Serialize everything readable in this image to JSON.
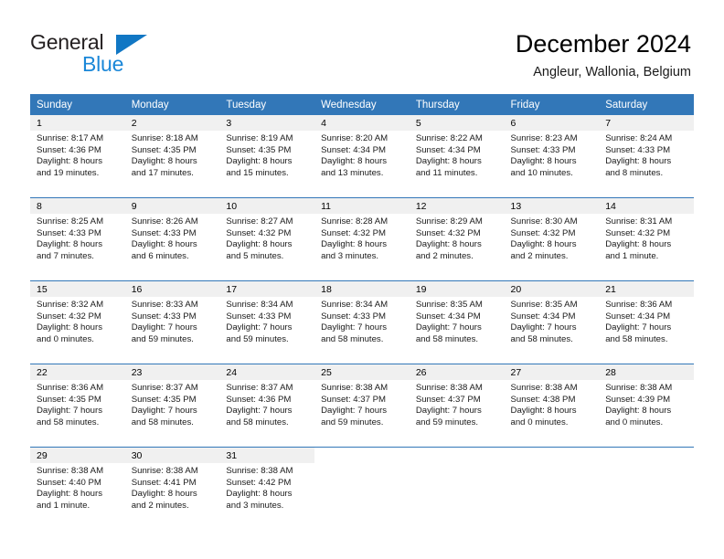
{
  "brand": {
    "name_part1": "General",
    "name_part2": "Blue",
    "logo_icon": "blue-triangle-icon",
    "colors": {
      "dark": "#231f20",
      "blue": "#1a87d8",
      "triangle": "#1177c4"
    }
  },
  "header": {
    "title": "December 2024",
    "subtitle": "Angleur, Wallonia, Belgium"
  },
  "theme": {
    "header_blue": "#3277b8",
    "daynum_band": "#f0f0f0",
    "text": "#1a1a1a"
  },
  "calendar": {
    "weekday_headers": [
      "Sunday",
      "Monday",
      "Tuesday",
      "Wednesday",
      "Thursday",
      "Friday",
      "Saturday"
    ],
    "weeks": [
      [
        {
          "day": "1",
          "sunrise": "Sunrise: 8:17 AM",
          "sunset": "Sunset: 4:36 PM",
          "daylight_line1": "Daylight: 8 hours",
          "daylight_line2": "and 19 minutes."
        },
        {
          "day": "2",
          "sunrise": "Sunrise: 8:18 AM",
          "sunset": "Sunset: 4:35 PM",
          "daylight_line1": "Daylight: 8 hours",
          "daylight_line2": "and 17 minutes."
        },
        {
          "day": "3",
          "sunrise": "Sunrise: 8:19 AM",
          "sunset": "Sunset: 4:35 PM",
          "daylight_line1": "Daylight: 8 hours",
          "daylight_line2": "and 15 minutes."
        },
        {
          "day": "4",
          "sunrise": "Sunrise: 8:20 AM",
          "sunset": "Sunset: 4:34 PM",
          "daylight_line1": "Daylight: 8 hours",
          "daylight_line2": "and 13 minutes."
        },
        {
          "day": "5",
          "sunrise": "Sunrise: 8:22 AM",
          "sunset": "Sunset: 4:34 PM",
          "daylight_line1": "Daylight: 8 hours",
          "daylight_line2": "and 11 minutes."
        },
        {
          "day": "6",
          "sunrise": "Sunrise: 8:23 AM",
          "sunset": "Sunset: 4:33 PM",
          "daylight_line1": "Daylight: 8 hours",
          "daylight_line2": "and 10 minutes."
        },
        {
          "day": "7",
          "sunrise": "Sunrise: 8:24 AM",
          "sunset": "Sunset: 4:33 PM",
          "daylight_line1": "Daylight: 8 hours",
          "daylight_line2": "and 8 minutes."
        }
      ],
      [
        {
          "day": "8",
          "sunrise": "Sunrise: 8:25 AM",
          "sunset": "Sunset: 4:33 PM",
          "daylight_line1": "Daylight: 8 hours",
          "daylight_line2": "and 7 minutes."
        },
        {
          "day": "9",
          "sunrise": "Sunrise: 8:26 AM",
          "sunset": "Sunset: 4:33 PM",
          "daylight_line1": "Daylight: 8 hours",
          "daylight_line2": "and 6 minutes."
        },
        {
          "day": "10",
          "sunrise": "Sunrise: 8:27 AM",
          "sunset": "Sunset: 4:32 PM",
          "daylight_line1": "Daylight: 8 hours",
          "daylight_line2": "and 5 minutes."
        },
        {
          "day": "11",
          "sunrise": "Sunrise: 8:28 AM",
          "sunset": "Sunset: 4:32 PM",
          "daylight_line1": "Daylight: 8 hours",
          "daylight_line2": "and 3 minutes."
        },
        {
          "day": "12",
          "sunrise": "Sunrise: 8:29 AM",
          "sunset": "Sunset: 4:32 PM",
          "daylight_line1": "Daylight: 8 hours",
          "daylight_line2": "and 2 minutes."
        },
        {
          "day": "13",
          "sunrise": "Sunrise: 8:30 AM",
          "sunset": "Sunset: 4:32 PM",
          "daylight_line1": "Daylight: 8 hours",
          "daylight_line2": "and 2 minutes."
        },
        {
          "day": "14",
          "sunrise": "Sunrise: 8:31 AM",
          "sunset": "Sunset: 4:32 PM",
          "daylight_line1": "Daylight: 8 hours",
          "daylight_line2": "and 1 minute."
        }
      ],
      [
        {
          "day": "15",
          "sunrise": "Sunrise: 8:32 AM",
          "sunset": "Sunset: 4:32 PM",
          "daylight_line1": "Daylight: 8 hours",
          "daylight_line2": "and 0 minutes."
        },
        {
          "day": "16",
          "sunrise": "Sunrise: 8:33 AM",
          "sunset": "Sunset: 4:33 PM",
          "daylight_line1": "Daylight: 7 hours",
          "daylight_line2": "and 59 minutes."
        },
        {
          "day": "17",
          "sunrise": "Sunrise: 8:34 AM",
          "sunset": "Sunset: 4:33 PM",
          "daylight_line1": "Daylight: 7 hours",
          "daylight_line2": "and 59 minutes."
        },
        {
          "day": "18",
          "sunrise": "Sunrise: 8:34 AM",
          "sunset": "Sunset: 4:33 PM",
          "daylight_line1": "Daylight: 7 hours",
          "daylight_line2": "and 58 minutes."
        },
        {
          "day": "19",
          "sunrise": "Sunrise: 8:35 AM",
          "sunset": "Sunset: 4:34 PM",
          "daylight_line1": "Daylight: 7 hours",
          "daylight_line2": "and 58 minutes."
        },
        {
          "day": "20",
          "sunrise": "Sunrise: 8:35 AM",
          "sunset": "Sunset: 4:34 PM",
          "daylight_line1": "Daylight: 7 hours",
          "daylight_line2": "and 58 minutes."
        },
        {
          "day": "21",
          "sunrise": "Sunrise: 8:36 AM",
          "sunset": "Sunset: 4:34 PM",
          "daylight_line1": "Daylight: 7 hours",
          "daylight_line2": "and 58 minutes."
        }
      ],
      [
        {
          "day": "22",
          "sunrise": "Sunrise: 8:36 AM",
          "sunset": "Sunset: 4:35 PM",
          "daylight_line1": "Daylight: 7 hours",
          "daylight_line2": "and 58 minutes."
        },
        {
          "day": "23",
          "sunrise": "Sunrise: 8:37 AM",
          "sunset": "Sunset: 4:35 PM",
          "daylight_line1": "Daylight: 7 hours",
          "daylight_line2": "and 58 minutes."
        },
        {
          "day": "24",
          "sunrise": "Sunrise: 8:37 AM",
          "sunset": "Sunset: 4:36 PM",
          "daylight_line1": "Daylight: 7 hours",
          "daylight_line2": "and 58 minutes."
        },
        {
          "day": "25",
          "sunrise": "Sunrise: 8:38 AM",
          "sunset": "Sunset: 4:37 PM",
          "daylight_line1": "Daylight: 7 hours",
          "daylight_line2": "and 59 minutes."
        },
        {
          "day": "26",
          "sunrise": "Sunrise: 8:38 AM",
          "sunset": "Sunset: 4:37 PM",
          "daylight_line1": "Daylight: 7 hours",
          "daylight_line2": "and 59 minutes."
        },
        {
          "day": "27",
          "sunrise": "Sunrise: 8:38 AM",
          "sunset": "Sunset: 4:38 PM",
          "daylight_line1": "Daylight: 8 hours",
          "daylight_line2": "and 0 minutes."
        },
        {
          "day": "28",
          "sunrise": "Sunrise: 8:38 AM",
          "sunset": "Sunset: 4:39 PM",
          "daylight_line1": "Daylight: 8 hours",
          "daylight_line2": "and 0 minutes."
        }
      ],
      [
        {
          "day": "29",
          "sunrise": "Sunrise: 8:38 AM",
          "sunset": "Sunset: 4:40 PM",
          "daylight_line1": "Daylight: 8 hours",
          "daylight_line2": "and 1 minute."
        },
        {
          "day": "30",
          "sunrise": "Sunrise: 8:38 AM",
          "sunset": "Sunset: 4:41 PM",
          "daylight_line1": "Daylight: 8 hours",
          "daylight_line2": "and 2 minutes."
        },
        {
          "day": "31",
          "sunrise": "Sunrise: 8:38 AM",
          "sunset": "Sunset: 4:42 PM",
          "daylight_line1": "Daylight: 8 hours",
          "daylight_line2": "and 3 minutes."
        },
        {
          "day": "",
          "sunrise": "",
          "sunset": "",
          "daylight_line1": "",
          "daylight_line2": ""
        },
        {
          "day": "",
          "sunrise": "",
          "sunset": "",
          "daylight_line1": "",
          "daylight_line2": ""
        },
        {
          "day": "",
          "sunrise": "",
          "sunset": "",
          "daylight_line1": "",
          "daylight_line2": ""
        },
        {
          "day": "",
          "sunrise": "",
          "sunset": "",
          "daylight_line1": "",
          "daylight_line2": ""
        }
      ]
    ]
  }
}
